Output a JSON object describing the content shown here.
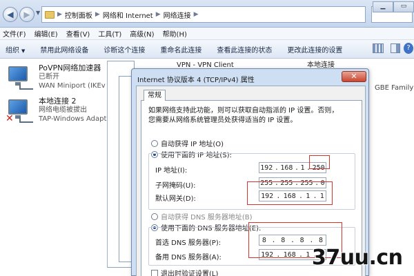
{
  "address": {
    "breadcrumb": [
      "控制面板",
      "网络和 Internet",
      "网络连接"
    ]
  },
  "menu": [
    "文件(F)",
    "编辑(E)",
    "查看(V)",
    "工具(T)",
    "高级(N)",
    "帮助(H)"
  ],
  "toolbar": {
    "organize": "组织",
    "items": [
      "禁用此网络设备",
      "诊断这个连接",
      "重命名此连接",
      "查看此连接的状态",
      "更改此连接的设置"
    ]
  },
  "connections": [
    {
      "name": "PoVPN网络加速器",
      "status": "已断开",
      "device": "WAN Miniport (IKEv"
    },
    {
      "name": "本地连接 2",
      "status": "网络电缆被拔出",
      "device": "TAP-Windows Adapt"
    }
  ],
  "background_windows": {
    "vpn_title": "VPN - VPN Client",
    "local_title": "本地连接",
    "local_device": "GBE Family Co"
  },
  "dialog": {
    "title": "Internet 协议版本 4 (TCP/IPv4) 属性",
    "close": "✕",
    "tab": "常规",
    "intro_line1": "如果网络支持此功能，则可以获取自动指派的 IP 设置。否则，",
    "intro_line2": "您需要从网络系统管理员处获得适当的 IP 设置。",
    "auto_ip": "自动获得 IP 地址(O)",
    "manual_ip": "使用下面的 IP 地址(S):",
    "ip_label": "IP 地址(I):",
    "ip": [
      "192",
      "168",
      "1",
      "250"
    ],
    "mask_label": "子网掩码(U):",
    "mask": [
      "255",
      "255",
      "255",
      "0"
    ],
    "gateway_label": "默认网关(D):",
    "gateway": [
      "192",
      "168",
      "1",
      "1"
    ],
    "auto_dns": "自动获得 DNS 服务器地址(B)",
    "manual_dns": "使用下面的 DNS 服务器地址(E):",
    "dns1_label": "首选 DNS 服务器(P):",
    "dns1": [
      "8",
      "8",
      "8",
      "8"
    ],
    "dns2_label": "备用 DNS 服务器(A):",
    "dns2": [
      "192",
      "168",
      "1",
      "1"
    ],
    "validate": "退出时验证设置(L)"
  },
  "watermark": "37uu.cn"
}
